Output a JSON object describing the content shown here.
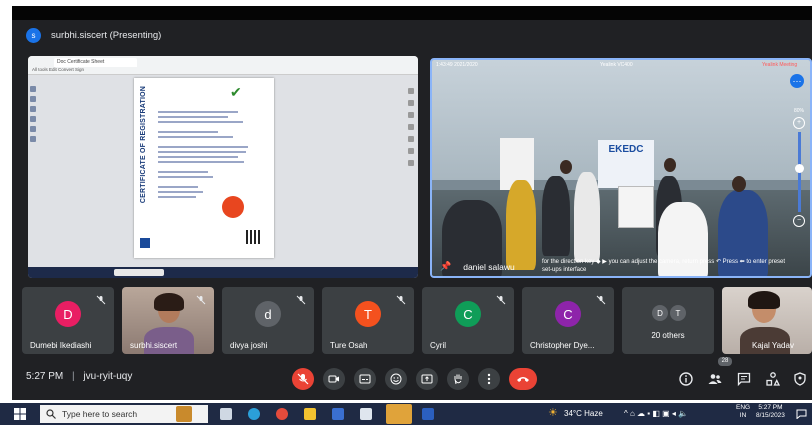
{
  "presenter": {
    "initial": "s",
    "label": "surbhi.siscert (Presenting)"
  },
  "shared_screen": {
    "tab_title": "Doc Certificate Sheet",
    "menu": "All tools  Edit  Convert  Sign",
    "certificate_vertical_text": "CERTIFICATE OF REGISTRATION"
  },
  "camera": {
    "overlay_left": "1:43:49  2021/2020",
    "overlay_middle": "Yealink VC400",
    "overlay_rec": "Yealink Meeting",
    "banner": "EKEDC",
    "zoom_pct": "80%",
    "name": "daniel salawu",
    "caption": "for the direction key ◆ ▶ you can adjust the camera, return press ↶ Press ⬅ to enter preset set-ups interface"
  },
  "participants": [
    {
      "name": "Dumebi Ikediashi",
      "initial": "D",
      "color": "#e91e63"
    },
    {
      "name": "surbhi.siscert",
      "initial": "",
      "color": ""
    },
    {
      "name": "divya joshi",
      "initial": "d",
      "color": "#5f6368"
    },
    {
      "name": "Ture Osah",
      "initial": "T",
      "color": "#f4511e"
    },
    {
      "name": "Cyril",
      "initial": "C",
      "color": "#0f9d58"
    },
    {
      "name": "Christopher Dye...",
      "initial": "C",
      "color": "#8e24aa"
    },
    {
      "name": "20 others",
      "initial": "",
      "color": ""
    },
    {
      "name": "Kajal Yadav",
      "initial": "",
      "color": ""
    }
  ],
  "others_initials": [
    "D",
    "T"
  ],
  "meeting": {
    "time": "5:27 PM",
    "code": "jvu-ryit-uqy",
    "participant_count": "28"
  },
  "taskbar": {
    "search_placeholder": "Type here to search",
    "weather": "34°C  Haze",
    "lang_line1": "ENG",
    "lang_line2": "IN",
    "clock_time": "5:27 PM",
    "clock_date": "8/15/2023"
  }
}
